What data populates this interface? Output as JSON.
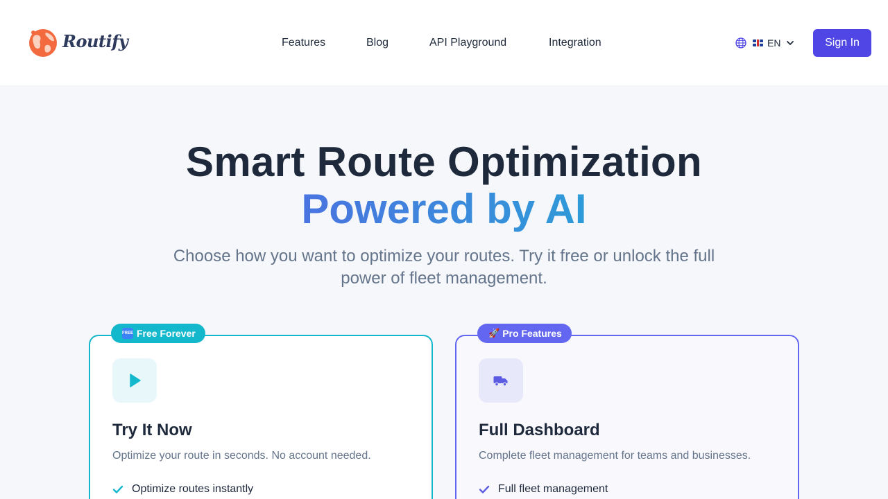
{
  "header": {
    "brand": "Routify",
    "nav": [
      "Features",
      "Blog",
      "API Playground",
      "Integration"
    ],
    "language": "EN",
    "signin_label": "Sign In"
  },
  "hero": {
    "title": "Smart Route Optimization",
    "accent": "Powered by AI",
    "subtitle": "Choose how you want to optimize your routes. Try it free or unlock the full power of fleet management."
  },
  "cards": [
    {
      "badge": "Free Forever",
      "title": "Try It Now",
      "description": "Optimize your route in seconds. No account needed.",
      "feature": "Optimize routes instantly",
      "icon": "play-icon"
    },
    {
      "badge": "Pro Features",
      "title": "Full Dashboard",
      "description": "Complete fleet management for teams and businesses.",
      "feature": "Full fleet management",
      "icon": "truck-icon"
    }
  ],
  "colors": {
    "primary": "#4f46e5",
    "teal": "#14b8cc",
    "indigo": "#6366f1",
    "brand_orange": "#f26a3d"
  }
}
